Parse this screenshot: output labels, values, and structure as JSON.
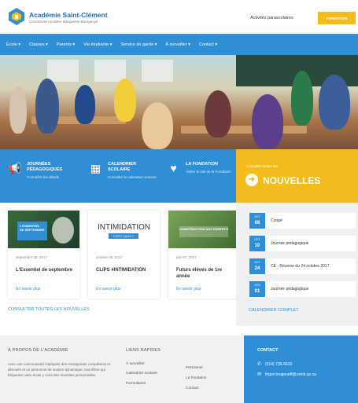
{
  "header": {
    "school_name": "Académie Saint-Clément",
    "school_sub": "Commission scolaire Marguerite-Bourgeoys",
    "activities_link": "Activités parascolaires",
    "cta_label": "FONDATION"
  },
  "nav": [
    "École ▾",
    "Classes ▾",
    "Parents ▾",
    "Vie étudiante ▾",
    "Service de garde ▾",
    "À surveiller ▾",
    "Contact ▾"
  ],
  "features": [
    {
      "icon": "megaphone-icon",
      "title": "JOURNÉES PÉDAGOGIQUES",
      "sub": "Connaître les détails"
    },
    {
      "icon": "calendar-icon",
      "title": "CALENDRIER SCOLAIRE",
      "sub": "Consulter le calendrier scolaire"
    },
    {
      "icon": "hand-heart-icon",
      "title": "LA FONDATION",
      "sub": "Visiter le site de la Fondation"
    }
  ],
  "news_box": {
    "small": "Consulter toutes les",
    "big": "NOUVELLES"
  },
  "cards": [
    {
      "img_text": "L'ESSENTIEL DE SEPTEMBRE",
      "date": "septembre 08, 2017",
      "title": "L'Essentiel de septembre",
      "more": "En savoir plus"
    },
    {
      "img_title": "INTIMIDATION",
      "img_badge": "C'EST QUOI ?",
      "date": "octobre 06, 2017",
      "title": "CLIPS #INTIMIDATION",
      "more": "En savoir plus"
    },
    {
      "img_text": "CONSTRUCTION AUX PARENTS",
      "date": "juin 07, 2017",
      "title": "Futurs élèves de 1re année",
      "more": "En savoir plus"
    }
  ],
  "all_news_link": "CONSULTER TOUTES LES NOUVELLES",
  "events": [
    {
      "month": "OCT",
      "day": "08",
      "title": "Congé"
    },
    {
      "month": "OCT",
      "day": "10",
      "title": "Journée pédagogique"
    },
    {
      "month": "OCT",
      "day": "24",
      "title": "CÉ - Réunion du 24 octobre 2017"
    },
    {
      "month": "NOV",
      "day": "01",
      "title": "Journée pédagogique"
    }
  ],
  "calendar_link": "CALENDRIER COMPLET",
  "footer": {
    "about_heading": "À PROPOS DE L'ACADÉMIE",
    "about_text": "Avec une communauté impliquée des enseignants compétents et dévoués et un personnel de soutien dynamique, tout élève qui fréquente notre école y vivra des réussites personnelles.",
    "links_heading": "LIENS RAPIDES",
    "links_col1": [
      "À surveiller",
      "Calendrier scolaire",
      "Formulaires"
    ],
    "links_col2": [
      "Personnel",
      "La fondation",
      "Contact"
    ],
    "contact_heading": "CONTACT",
    "phone": "(514) 735-6610",
    "email": "frigon.lougoueff@csmb.qc.ca"
  },
  "colors": {
    "primary": "#2e8fd6",
    "accent": "#f3bc1a"
  }
}
